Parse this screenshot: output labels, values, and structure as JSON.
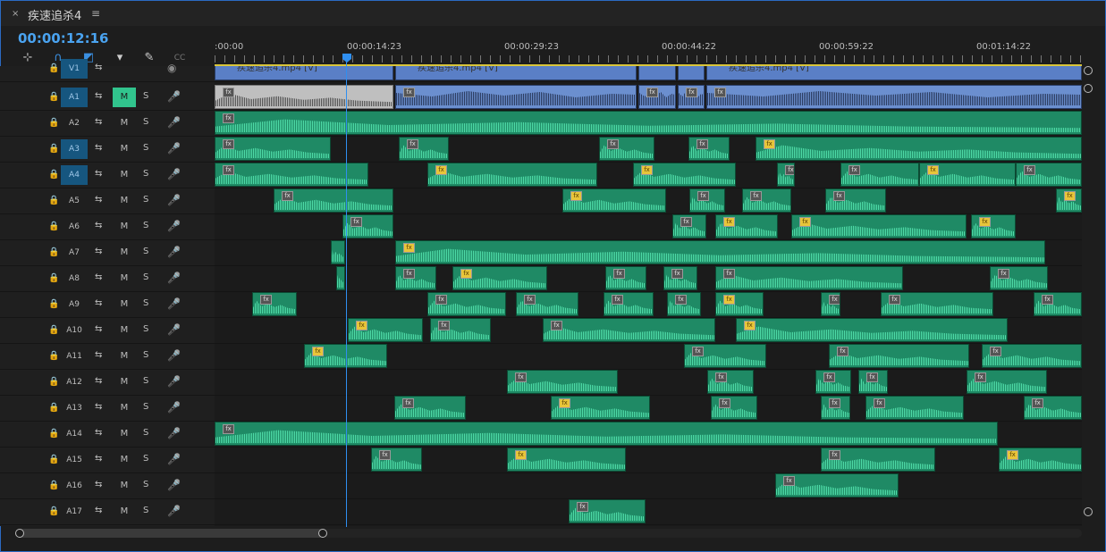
{
  "tab": {
    "close": "×",
    "title": "疾速追杀4",
    "menu": "≡"
  },
  "timecode": "00:00:12:16",
  "tools": [
    "insert-snap-icon",
    "magnet-icon",
    "linked-select-icon",
    "marker-icon",
    "wrench-icon",
    "captions-icon"
  ],
  "ruler": {
    "labels": [
      ":00:00",
      "00:00:14:23",
      "00:00:29:23",
      "00:00:44:22",
      "00:00:59:22",
      "00:01:14:22"
    ]
  },
  "tracks": [
    {
      "name": "V1",
      "target": true
    },
    {
      "name": "A1",
      "target": true,
      "mute": true
    },
    {
      "name": "A2",
      "target": false
    },
    {
      "name": "A3",
      "target": true
    },
    {
      "name": "A4",
      "target": true
    },
    {
      "name": "A5",
      "target": false
    },
    {
      "name": "A6",
      "target": false
    },
    {
      "name": "A7",
      "target": false
    },
    {
      "name": "A8",
      "target": false
    },
    {
      "name": "A9",
      "target": false
    },
    {
      "name": "A10",
      "target": false
    },
    {
      "name": "A11",
      "target": false
    },
    {
      "name": "A12",
      "target": false
    },
    {
      "name": "A13",
      "target": false
    },
    {
      "name": "A14",
      "target": false
    },
    {
      "name": "A15",
      "target": false
    },
    {
      "name": "A16",
      "target": false
    },
    {
      "name": "A17",
      "target": false
    }
  ],
  "track_buttons": {
    "m": "M",
    "s": "S",
    "lock": "🔒",
    "sync": "⇆",
    "mic": "🎤"
  },
  "fx_label": "fx",
  "clips": [
    {
      "track": 0,
      "start": 0,
      "len": 200,
      "type": "v",
      "label": "疾速追杀4.mp4 [V]"
    },
    {
      "track": 0,
      "start": 202,
      "len": 270,
      "type": "v",
      "label": "疾速追杀4.mp4 [V]"
    },
    {
      "track": 0,
      "start": 474,
      "len": 42,
      "type": "v",
      "label": ""
    },
    {
      "track": 0,
      "start": 518,
      "len": 30,
      "type": "v",
      "label": ""
    },
    {
      "track": 0,
      "start": 550,
      "len": 420,
      "type": "v",
      "label": "疾速追杀4.mp4 [V]"
    },
    {
      "track": 1,
      "start": 0,
      "len": 200,
      "type": "sel",
      "fx": "g"
    },
    {
      "track": 1,
      "start": 202,
      "len": 270,
      "type": "a1",
      "fx": "g"
    },
    {
      "track": 1,
      "start": 474,
      "len": 42,
      "type": "a1",
      "fx": "g"
    },
    {
      "track": 1,
      "start": 518,
      "len": 30,
      "type": "a1",
      "fx": "g"
    },
    {
      "track": 1,
      "start": 550,
      "len": 420,
      "type": "a1",
      "fx": "g"
    },
    {
      "track": 2,
      "start": 0,
      "len": 970,
      "fx": "g"
    },
    {
      "track": 3,
      "start": 0,
      "len": 130,
      "fx": "g"
    },
    {
      "track": 3,
      "start": 206,
      "len": 56,
      "fx": "g"
    },
    {
      "track": 3,
      "start": 430,
      "len": 62,
      "fx": "g"
    },
    {
      "track": 3,
      "start": 530,
      "len": 46,
      "fx": "g"
    },
    {
      "track": 3,
      "start": 605,
      "len": 365,
      "fx": "y"
    },
    {
      "track": 4,
      "start": 0,
      "len": 172,
      "fx": "g"
    },
    {
      "track": 4,
      "start": 238,
      "len": 190,
      "fx": "y"
    },
    {
      "track": 4,
      "start": 468,
      "len": 115,
      "fx": "y"
    },
    {
      "track": 4,
      "start": 629,
      "len": 20,
      "fx": "g"
    },
    {
      "track": 4,
      "start": 700,
      "len": 88,
      "fx": "g"
    },
    {
      "track": 4,
      "start": 788,
      "len": 108,
      "fx": "y"
    },
    {
      "track": 4,
      "start": 896,
      "len": 74,
      "fx": "g"
    },
    {
      "track": 5,
      "start": 66,
      "len": 134,
      "fx": "g"
    },
    {
      "track": 5,
      "start": 389,
      "len": 116,
      "fx": "y"
    },
    {
      "track": 5,
      "start": 531,
      "len": 40,
      "fx": "g"
    },
    {
      "track": 5,
      "start": 590,
      "len": 55,
      "fx": "g"
    },
    {
      "track": 5,
      "start": 683,
      "len": 68,
      "fx": "g"
    },
    {
      "track": 5,
      "start": 941,
      "len": 29,
      "fx": "y"
    },
    {
      "track": 6,
      "start": 143,
      "len": 57,
      "fx": "g"
    },
    {
      "track": 6,
      "start": 512,
      "len": 38,
      "fx": "g"
    },
    {
      "track": 6,
      "start": 560,
      "len": 70,
      "fx": "y"
    },
    {
      "track": 6,
      "start": 645,
      "len": 196,
      "fx": "y"
    },
    {
      "track": 6,
      "start": 846,
      "len": 50,
      "fx": "y"
    },
    {
      "track": 7,
      "start": 130,
      "len": 16,
      "fx": ""
    },
    {
      "track": 7,
      "start": 202,
      "len": 727,
      "fx": "y"
    },
    {
      "track": 8,
      "start": 136,
      "len": 10,
      "fx": ""
    },
    {
      "track": 8,
      "start": 202,
      "len": 46,
      "fx": "g"
    },
    {
      "track": 8,
      "start": 266,
      "len": 106,
      "fx": "y"
    },
    {
      "track": 8,
      "start": 437,
      "len": 46,
      "fx": "g"
    },
    {
      "track": 8,
      "start": 502,
      "len": 38,
      "fx": "g"
    },
    {
      "track": 8,
      "start": 560,
      "len": 210,
      "fx": "g"
    },
    {
      "track": 8,
      "start": 867,
      "len": 65,
      "fx": "g"
    },
    {
      "track": 9,
      "start": 42,
      "len": 50,
      "fx": "g"
    },
    {
      "track": 9,
      "start": 238,
      "len": 88,
      "fx": "g"
    },
    {
      "track": 9,
      "start": 337,
      "len": 70,
      "fx": "g"
    },
    {
      "track": 9,
      "start": 435,
      "len": 56,
      "fx": "g"
    },
    {
      "track": 9,
      "start": 506,
      "len": 38,
      "fx": "g"
    },
    {
      "track": 9,
      "start": 560,
      "len": 54,
      "fx": "y"
    },
    {
      "track": 9,
      "start": 678,
      "len": 22,
      "fx": "g"
    },
    {
      "track": 9,
      "start": 745,
      "len": 126,
      "fx": "g"
    },
    {
      "track": 9,
      "start": 916,
      "len": 54,
      "fx": "g"
    },
    {
      "track": 10,
      "start": 149,
      "len": 84,
      "fx": "y"
    },
    {
      "track": 10,
      "start": 241,
      "len": 68,
      "fx": "g"
    },
    {
      "track": 10,
      "start": 367,
      "len": 193,
      "fx": "g"
    },
    {
      "track": 10,
      "start": 583,
      "len": 304,
      "fx": "y"
    },
    {
      "track": 11,
      "start": 100,
      "len": 93,
      "fx": "y"
    },
    {
      "track": 11,
      "start": 525,
      "len": 92,
      "fx": "g"
    },
    {
      "track": 11,
      "start": 687,
      "len": 157,
      "fx": "g"
    },
    {
      "track": 11,
      "start": 858,
      "len": 112,
      "fx": "g"
    },
    {
      "track": 12,
      "start": 327,
      "len": 124,
      "fx": "g"
    },
    {
      "track": 12,
      "start": 551,
      "len": 52,
      "fx": "g"
    },
    {
      "track": 12,
      "start": 672,
      "len": 40,
      "fx": "g"
    },
    {
      "track": 12,
      "start": 720,
      "len": 33,
      "fx": "g"
    },
    {
      "track": 12,
      "start": 841,
      "len": 90,
      "fx": "g"
    },
    {
      "track": 13,
      "start": 201,
      "len": 80,
      "fx": "g"
    },
    {
      "track": 13,
      "start": 376,
      "len": 111,
      "fx": "y"
    },
    {
      "track": 13,
      "start": 555,
      "len": 52,
      "fx": "g"
    },
    {
      "track": 13,
      "start": 678,
      "len": 33,
      "fx": "g"
    },
    {
      "track": 13,
      "start": 728,
      "len": 110,
      "fx": "g"
    },
    {
      "track": 13,
      "start": 905,
      "len": 65,
      "fx": "g"
    },
    {
      "track": 14,
      "start": 0,
      "len": 876,
      "fx": "g"
    },
    {
      "track": 15,
      "start": 175,
      "len": 57,
      "fx": "g"
    },
    {
      "track": 15,
      "start": 327,
      "len": 133,
      "fx": "y"
    },
    {
      "track": 15,
      "start": 678,
      "len": 128,
      "fx": "g"
    },
    {
      "track": 15,
      "start": 877,
      "len": 93,
      "fx": "y"
    },
    {
      "track": 16,
      "start": 627,
      "len": 138,
      "fx": "g"
    },
    {
      "track": 17,
      "start": 396,
      "len": 86,
      "fx": "g"
    }
  ]
}
